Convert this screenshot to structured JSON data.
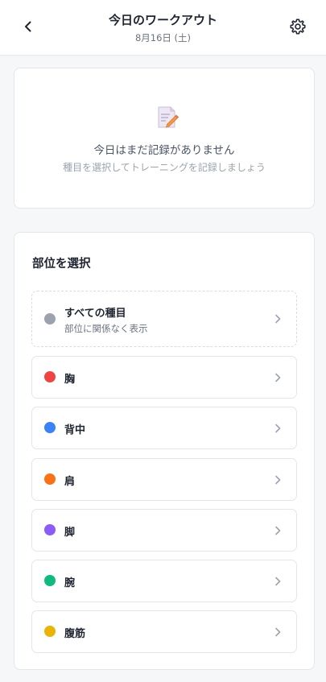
{
  "header": {
    "title": "今日のワークアウト",
    "date": "8月16日 (土)"
  },
  "empty_state": {
    "icon": "memo-pencil-icon",
    "title": "今日はまだ記録がありません",
    "subtitle": "種目を選択してトレーニングを記録しましょう"
  },
  "body_parts": {
    "heading": "部位を選択",
    "all": {
      "label": "すべての種目",
      "description": "部位に関係なく表示",
      "color": "#9ca3af"
    },
    "items": [
      {
        "label": "胸",
        "color": "#ef4444"
      },
      {
        "label": "背中",
        "color": "#3b82f6"
      },
      {
        "label": "肩",
        "color": "#f97316"
      },
      {
        "label": "脚",
        "color": "#8b5cf6"
      },
      {
        "label": "腕",
        "color": "#10b981"
      },
      {
        "label": "腹筋",
        "color": "#eab308"
      }
    ]
  }
}
